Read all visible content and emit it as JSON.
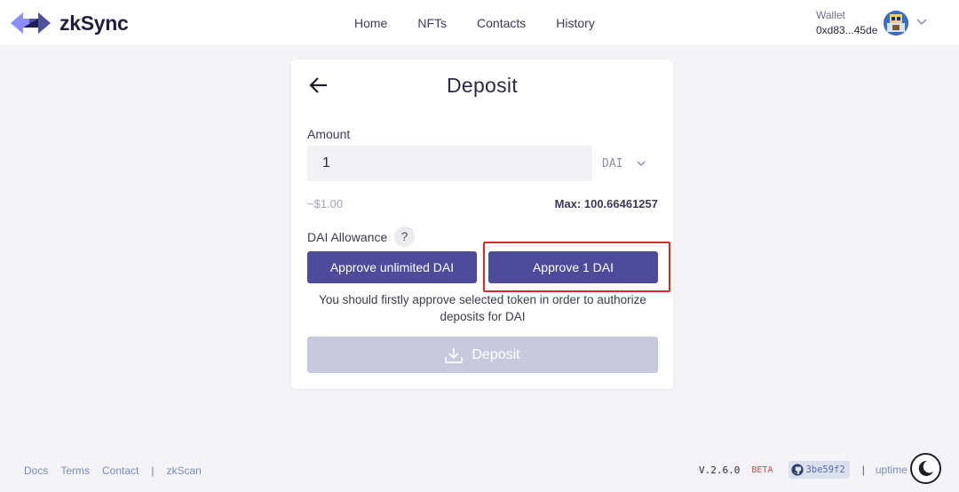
{
  "header": {
    "brand": "zkSync",
    "nav": [
      "Home",
      "NFTs",
      "Contacts",
      "History"
    ],
    "wallet_label": "Wallet",
    "wallet_address": "0xd83...45de"
  },
  "deposit": {
    "title": "Deposit",
    "amount_label": "Amount",
    "amount_value": "1",
    "token": "DAI",
    "usd_value": "~$1.00",
    "max": "Max: 100.66461257",
    "allowance_label": "DAI Allowance",
    "help": "?",
    "approve_unlimited": "Approve unlimited DAI",
    "approve_amount": "Approve 1 DAI",
    "hint": "You should firstly approve selected token in order to authorize deposits for DAI",
    "deposit_button": "Deposit"
  },
  "footer": {
    "links": [
      "Docs",
      "Terms",
      "Contact"
    ],
    "sep": "|",
    "zkscan": "zkScan",
    "version": "V.2.6.0",
    "beta": "BETA",
    "commit": "3be59f2",
    "uptime": "uptime"
  },
  "colors": {
    "primary": "#4e4c9a",
    "disabled": "#c9c9dd",
    "highlight": "#d9292c",
    "background": "#f4f4f6"
  },
  "icons": [
    "zksync-logo-icon",
    "back-arrow-icon",
    "chevron-down-icon",
    "help-icon",
    "download-icon",
    "github-icon",
    "moon-icon"
  ]
}
